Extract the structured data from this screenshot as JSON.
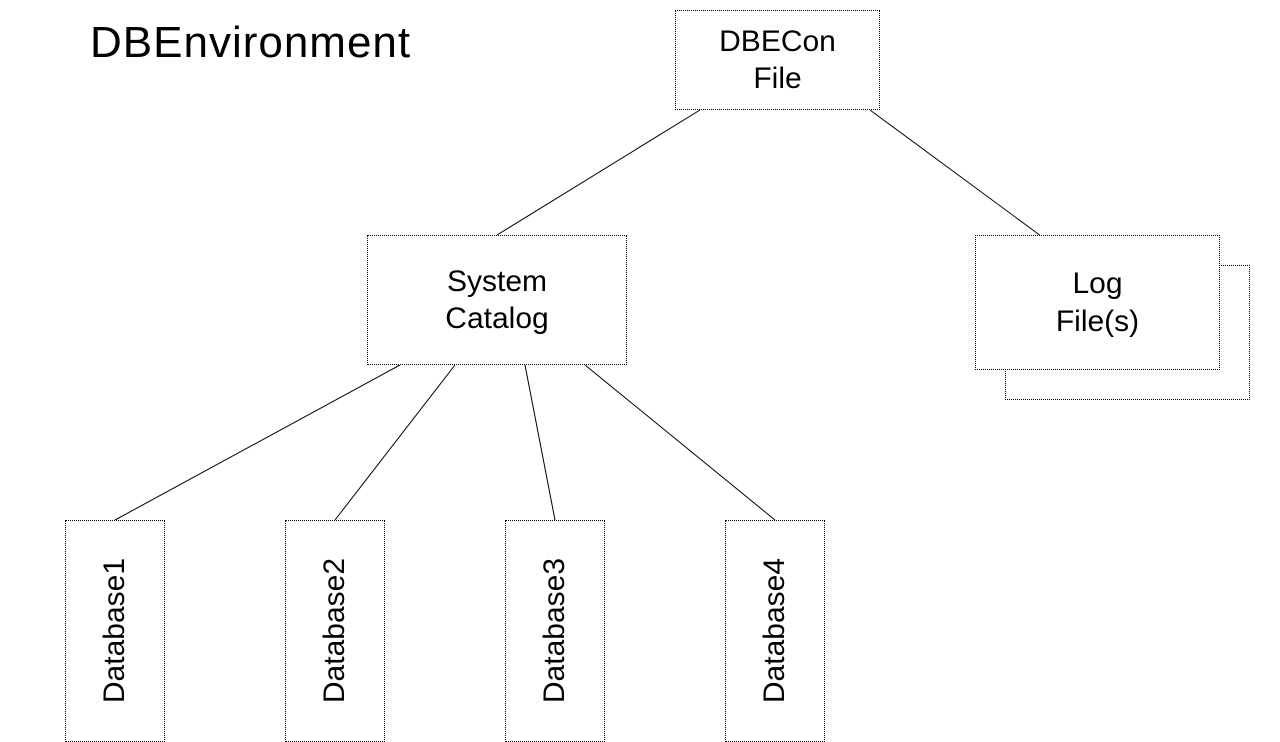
{
  "title": "DBEnvironment",
  "nodes": {
    "dbecon": {
      "line1": "DBECon",
      "line2": "File"
    },
    "system_catalog": {
      "line1": "System",
      "line2": "Catalog"
    },
    "log_files": {
      "line1": "Log",
      "line2": "File(s)"
    },
    "databases": [
      {
        "label": "Database1"
      },
      {
        "label": "Database2"
      },
      {
        "label": "Database3"
      },
      {
        "label": "Database4"
      }
    ]
  },
  "diagram": {
    "description": "Hierarchical structure of a DBEnvironment. A DBECon File is the root, connecting to a System Catalog and one or more Log Files. The System Catalog in turn connects to multiple databases (Database1 through Database4).",
    "edges": [
      [
        "DBECon File",
        "System Catalog"
      ],
      [
        "DBECon File",
        "Log File(s)"
      ],
      [
        "System Catalog",
        "Database1"
      ],
      [
        "System Catalog",
        "Database2"
      ],
      [
        "System Catalog",
        "Database3"
      ],
      [
        "System Catalog",
        "Database4"
      ]
    ]
  }
}
